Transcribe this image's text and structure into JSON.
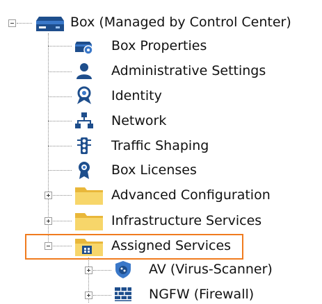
{
  "tree": {
    "root": {
      "label": "Box (Managed by Control Center)",
      "icon": "box-server-icon",
      "expanded": true
    },
    "children": [
      {
        "label": "Box Properties",
        "icon": "box-properties-icon"
      },
      {
        "label": "Administrative Settings",
        "icon": "user-admin-icon"
      },
      {
        "label": "Identity",
        "icon": "identity-badge-icon"
      },
      {
        "label": "Network",
        "icon": "network-icon"
      },
      {
        "label": "Traffic Shaping",
        "icon": "traffic-light-icon"
      },
      {
        "label": "Box Licenses",
        "icon": "license-medal-icon"
      },
      {
        "label": "Advanced Configuration",
        "icon": "folder-icon",
        "expandable": true,
        "expanded": false
      },
      {
        "label": "Infrastructure Services",
        "icon": "folder-icon",
        "expandable": true,
        "expanded": false
      },
      {
        "label": "Assigned Services",
        "icon": "folder-services-icon",
        "expandable": true,
        "expanded": true,
        "highlighted": true
      }
    ],
    "assigned_children": [
      {
        "label": "AV (Virus-Scanner)",
        "icon": "virus-scanner-icon",
        "expandable": true
      },
      {
        "label": "NGFW (Firewall)",
        "icon": "firewall-icon",
        "expandable": true
      }
    ]
  },
  "colors": {
    "highlight_border": "#f07b1e",
    "icon_blue": "#1e4e8c",
    "folder_yellow": "#f2c84b",
    "connector": "#8a8a8a"
  }
}
